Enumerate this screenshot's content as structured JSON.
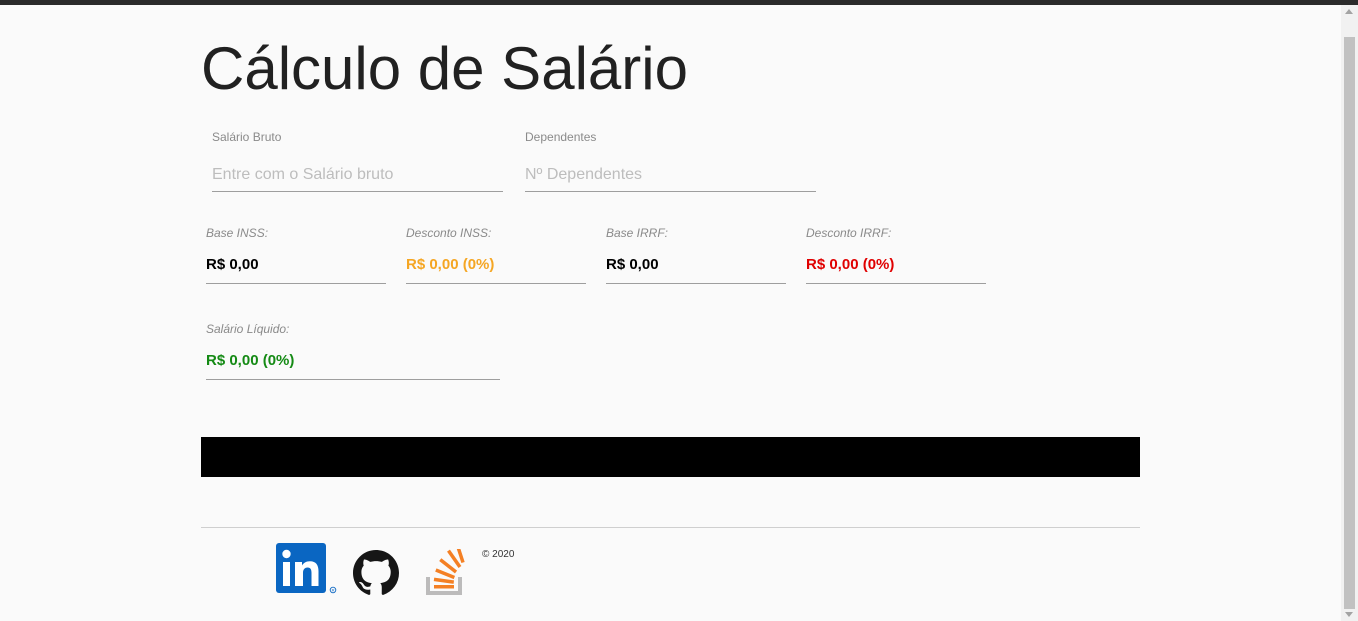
{
  "page": {
    "title": "Cálculo de Salário"
  },
  "form": {
    "salario_bruto": {
      "label": "Salário Bruto",
      "placeholder": "Entre com o Salário bruto"
    },
    "dependentes": {
      "label": "Dependentes",
      "placeholder": "Nº Dependentes"
    }
  },
  "results": {
    "base_inss": {
      "label": "Base INSS:",
      "value": "R$ 0,00",
      "color": "#000000"
    },
    "desconto_inss": {
      "label": "Desconto INSS:",
      "value": "R$ 0,00 (0%)",
      "color": "#f5a623"
    },
    "base_irrf": {
      "label": "Base IRRF:",
      "value": "R$ 0,00",
      "color": "#000000"
    },
    "desconto_irrf": {
      "label": "Desconto IRRF:",
      "value": "R$ 0,00 (0%)",
      "color": "#e00000"
    },
    "salario_liquido": {
      "label": "Salário Líquido:",
      "value": "R$ 0,00 (0%)",
      "color": "#148a14"
    }
  },
  "footer": {
    "icons": [
      "linkedin-icon",
      "github-icon",
      "stackoverflow-icon"
    ],
    "copyright": "© 2020"
  }
}
